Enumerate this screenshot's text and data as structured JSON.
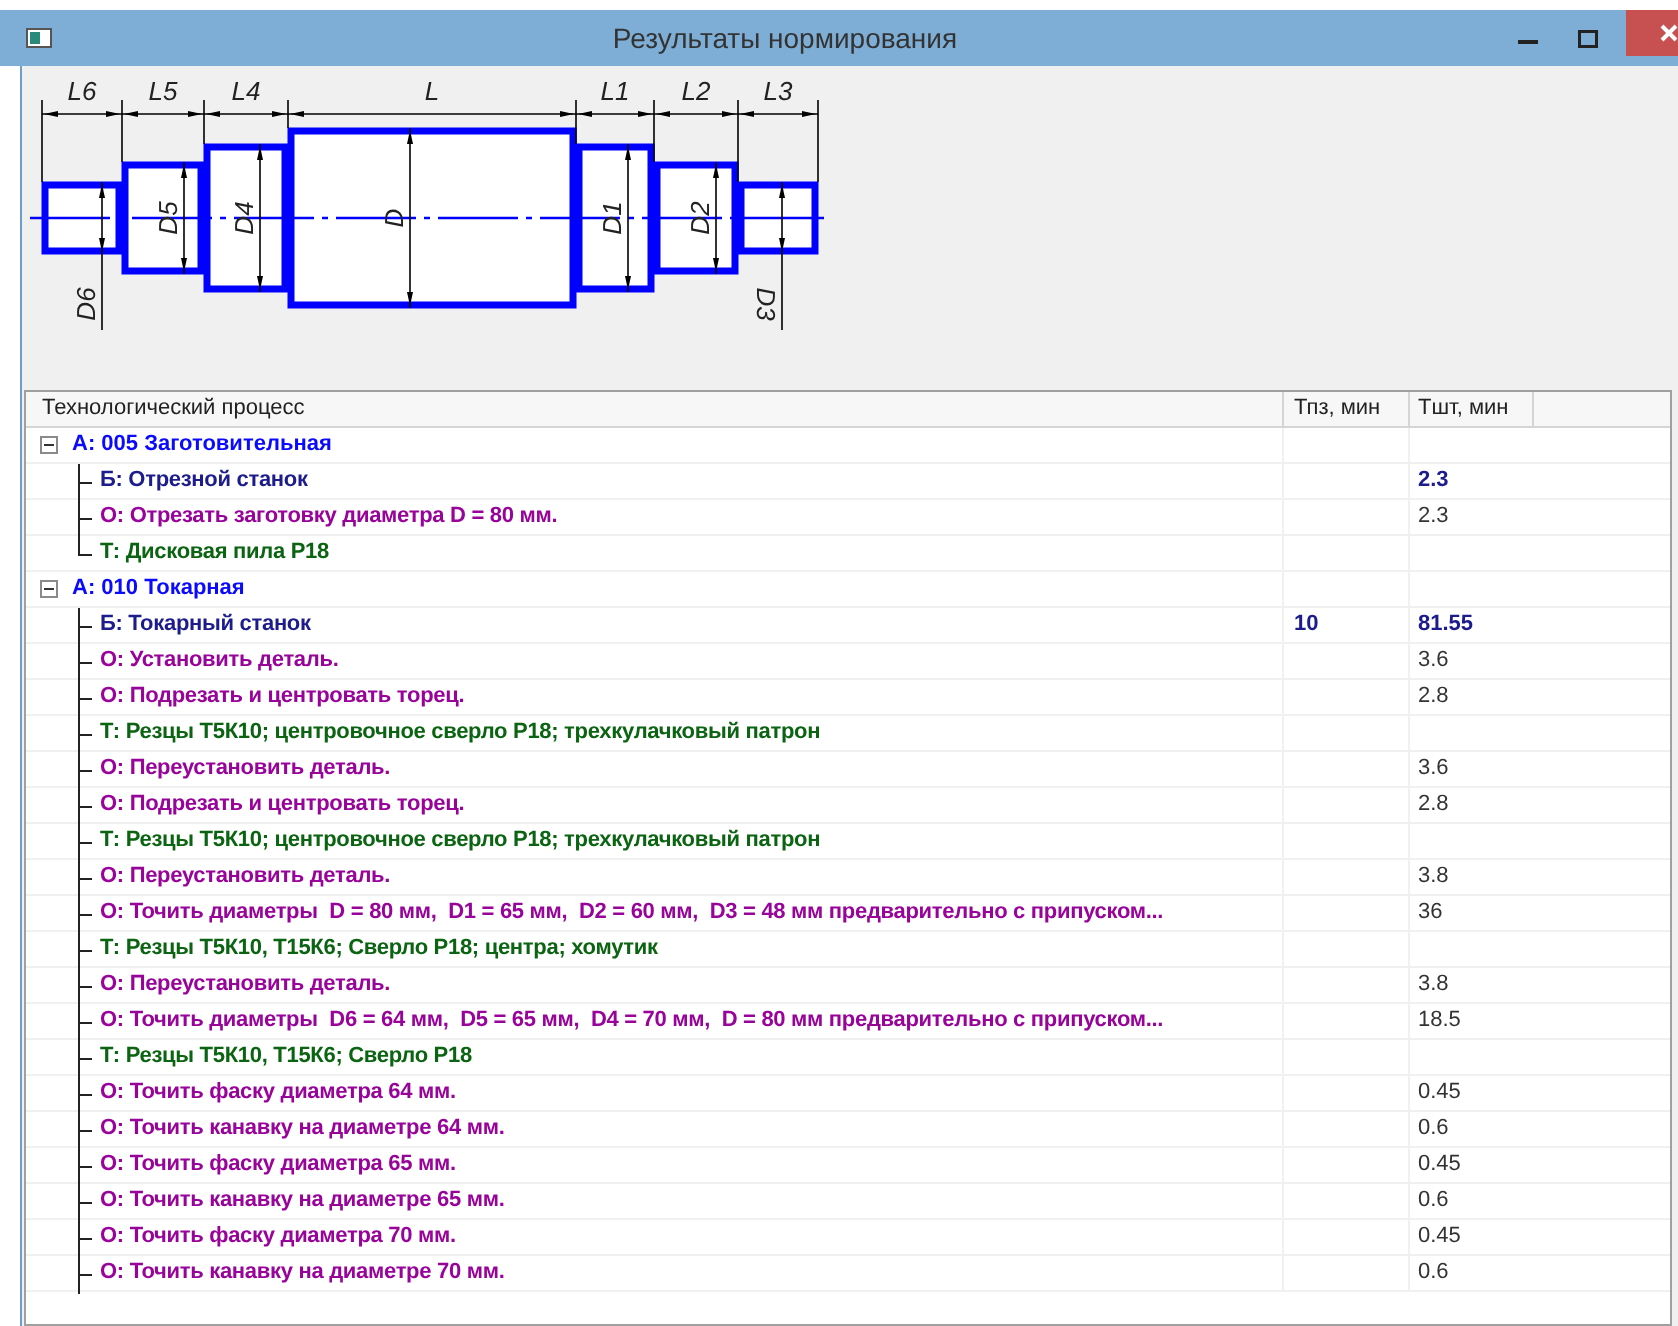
{
  "window": {
    "title": "Результаты нормирования"
  },
  "drawing": {
    "sections": [
      {
        "length": "L6",
        "diameter": "D6"
      },
      {
        "length": "L5",
        "diameter": "D5"
      },
      {
        "length": "L4",
        "diameter": "D4"
      },
      {
        "length": "L",
        "diameter": "D"
      },
      {
        "length": "L1",
        "diameter": "D1"
      },
      {
        "length": "L2",
        "diameter": "D2"
      },
      {
        "length": "L3",
        "diameter": "D3"
      }
    ]
  },
  "table": {
    "columns": [
      "Технологический процесс",
      "Тпз, мин",
      "Тшт, мин"
    ],
    "groups": [
      {
        "label": "А: 005 Заготовительная",
        "expanded": true,
        "children": [
          {
            "kind": "machine",
            "label": "Б: Отрезной станок",
            "tsht": "2.3"
          },
          {
            "kind": "operation",
            "label": "О: Отрезать заготовку диаметра D = 80 мм.",
            "tsht": "2.3"
          },
          {
            "kind": "tool",
            "label": "Т: Дисковая пила Р18"
          }
        ]
      },
      {
        "label": "А: 010 Токарная",
        "expanded": true,
        "children": [
          {
            "kind": "machine",
            "label": "Б: Токарный станок",
            "tpz": "10",
            "tsht": "81.55"
          },
          {
            "kind": "operation",
            "label": "О: Установить деталь.",
            "tsht": "3.6"
          },
          {
            "kind": "operation",
            "label": "О: Подрезать и центровать торец.",
            "tsht": "2.8"
          },
          {
            "kind": "tool",
            "label": "Т: Резцы Т5К10; центровочное сверло Р18; трехкулачковый патрон"
          },
          {
            "kind": "operation",
            "label": "О: Переустановить деталь.",
            "tsht": "3.6"
          },
          {
            "kind": "operation",
            "label": "О: Подрезать и центровать торец.",
            "tsht": "2.8"
          },
          {
            "kind": "tool",
            "label": "Т: Резцы Т5К10; центровочное сверло Р18; трехкулачковый патрон"
          },
          {
            "kind": "operation",
            "label": "О: Переустановить деталь.",
            "tsht": "3.8"
          },
          {
            "kind": "operation",
            "label": "О: Точить диаметры  D = 80 мм,  D1 = 65 мм,  D2 = 60 мм,  D3 = 48 мм предварительно с припуском...",
            "tsht": "36"
          },
          {
            "kind": "tool",
            "label": "Т: Резцы Т5К10, Т15К6; Сверло Р18; центра; хомутик"
          },
          {
            "kind": "operation",
            "label": "О: Переустановить деталь.",
            "tsht": "3.8"
          },
          {
            "kind": "operation",
            "label": "О: Точить диаметры  D6 = 64 мм,  D5 = 65 мм,  D4 = 70 мм,  D = 80 мм предварительно с припуском...",
            "tsht": "18.5"
          },
          {
            "kind": "tool",
            "label": "Т: Резцы Т5К10, Т15К6; Сверло Р18"
          },
          {
            "kind": "operation",
            "label": "О: Точить фаску диаметра 64 мм.",
            "tsht": "0.45"
          },
          {
            "kind": "operation",
            "label": "О: Точить канавку на диаметре 64 мм.",
            "tsht": "0.6"
          },
          {
            "kind": "operation",
            "label": "О: Точить фаску диаметра 65 мм.",
            "tsht": "0.45"
          },
          {
            "kind": "operation",
            "label": "О: Точить канавку на диаметре 65 мм.",
            "tsht": "0.6"
          },
          {
            "kind": "operation",
            "label": "О: Точить фаску диаметра 70 мм.",
            "tsht": "0.45"
          },
          {
            "kind": "operation",
            "label": "О: Точить канавку на диаметре 70 мм.",
            "tsht": "0.6"
          }
        ]
      }
    ]
  }
}
